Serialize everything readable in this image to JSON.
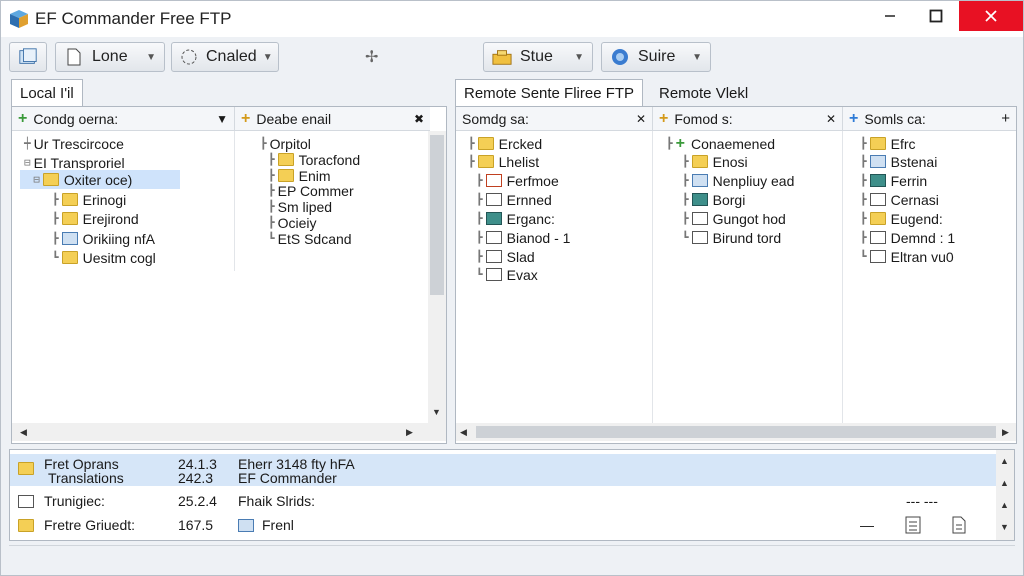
{
  "window": {
    "title": "EF Commander Free FTP"
  },
  "toolbar": {
    "btn1_label": "Lone",
    "btn2_label": "Cnaled",
    "btn3_label": "Stue",
    "btn4_label": "Suire"
  },
  "tabs": {
    "local": "Local I'il",
    "remote": "Remote Sente Fliree FTP",
    "remote2": "Remote Vlekl"
  },
  "local": {
    "col1_title": "Condg oerna:",
    "col2_title": "Deabe enail",
    "col1_items": [
      "Ur Trescircoce",
      "EI Transproriel",
      "Oxiter oce)",
      "Erinogi",
      "Erejirond",
      "Orikiing nfA",
      "Uesitm cogl"
    ],
    "col2_items": [
      "Orpitol",
      "Toracfond",
      "Enim",
      "EP Commer",
      "Sm liped",
      "Ocieiy",
      "EtS Sdcand"
    ]
  },
  "remote": {
    "col1_title": "Somdg sa:",
    "col2_title": "Fomod s:",
    "col3_title": "Somls ca:",
    "col1_items": [
      "Ercked",
      "Lhelist",
      "Ferfmoe",
      "Ernned",
      "Erganc:",
      "Bianod - 1",
      "Slad",
      "Evax"
    ],
    "col2_items": [
      "Conaemened",
      "Enosi",
      "Nenpliuy ead",
      "Borgi",
      "Gungot hod",
      "Birund tord"
    ],
    "col3_items": [
      "Efrc",
      "Bstenai",
      "Ferrin",
      "Cernasi",
      "Eugend:",
      "Demnd : 1",
      "Eltran vu0"
    ]
  },
  "queue": [
    {
      "name": "Fret Oprans",
      "name2": "Translations",
      "size": "24.1.3",
      "size2": "242.3",
      "desc": "Eherr 3148 fty hFA",
      "desc2": "EF Commander"
    },
    {
      "name": "Trunigiec:",
      "size": "25.2.4",
      "desc": "Fhaik Slrids:",
      "extra": "--- ---"
    },
    {
      "name": "Fretre Griuedt:",
      "size": "167.5",
      "desc": "Frenl",
      "extra": "—"
    }
  ]
}
